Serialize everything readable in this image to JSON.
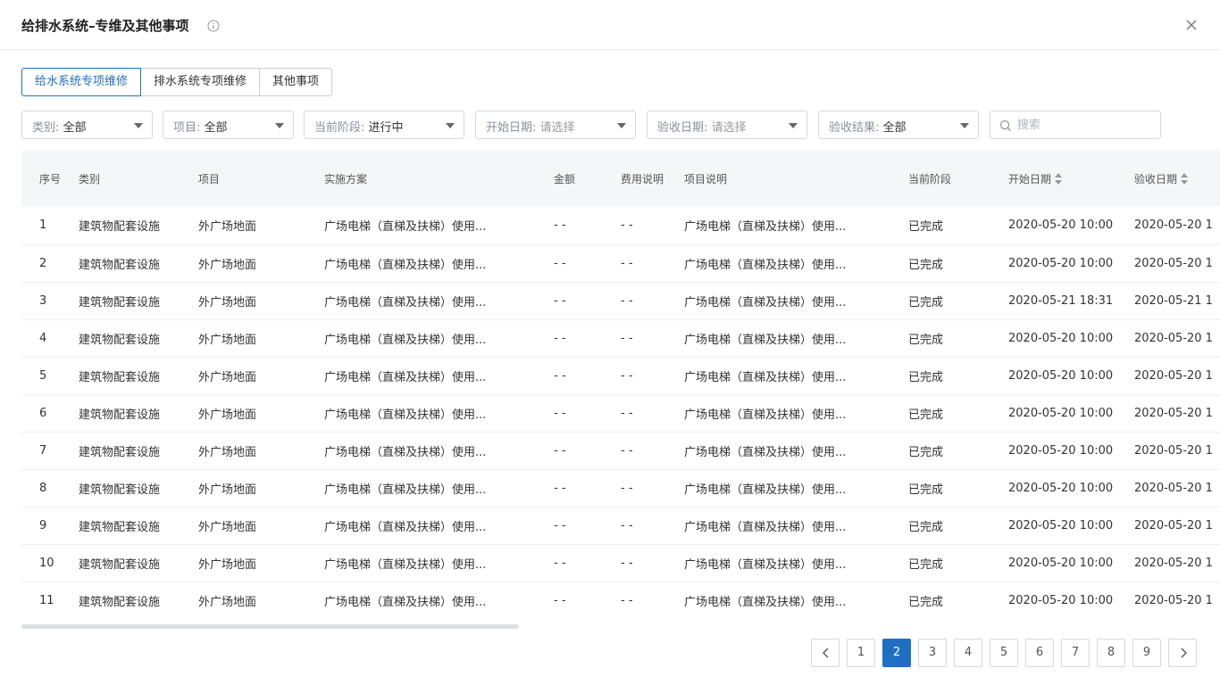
{
  "title": "给排水系统–专维及其他事项",
  "tabs": [
    {
      "label": "给水系统专项维修",
      "active": true
    },
    {
      "label": "排水系统专项维修",
      "active": false
    },
    {
      "label": "其他事项",
      "active": false
    }
  ],
  "filters": [
    {
      "label": "类别:",
      "value": "全部"
    },
    {
      "label": "项目:",
      "value": "全部"
    },
    {
      "label": "当前阶段:",
      "value": "进行中"
    },
    {
      "label": "开始日期:",
      "value": "请选择"
    },
    {
      "label": "验收日期:",
      "value": "请选择"
    },
    {
      "label": "验收结果:",
      "value": "全部"
    }
  ],
  "search": {
    "placeholder": "搜索"
  },
  "table": {
    "columns": [
      "序号",
      "类别",
      "项目",
      "实施方案",
      "金额",
      "费用说明",
      "项目说明",
      "当前阶段",
      "开始日期",
      "验收日期"
    ],
    "rows": [
      [
        "1",
        "建筑物配套设施",
        "外广场地面",
        "广场电梯（直梯及扶梯）使用...",
        "- -",
        "- -",
        "广场电梯（直梯及扶梯）使用...",
        "已完成",
        "2020-05-20 10:00",
        "2020-05-20 1"
      ],
      [
        "2",
        "建筑物配套设施",
        "外广场地面",
        "广场电梯（直梯及扶梯）使用...",
        "- -",
        "- -",
        "广场电梯（直梯及扶梯）使用...",
        "已完成",
        "2020-05-20 10:00",
        "2020-05-20 1"
      ],
      [
        "3",
        "建筑物配套设施",
        "外广场地面",
        "广场电梯（直梯及扶梯）使用...",
        "- -",
        "- -",
        "广场电梯（直梯及扶梯）使用...",
        "已完成",
        "2020-05-21 18:31",
        "2020-05-21 1"
      ],
      [
        "4",
        "建筑物配套设施",
        "外广场地面",
        "广场电梯（直梯及扶梯）使用...",
        "- -",
        "- -",
        "广场电梯（直梯及扶梯）使用...",
        "已完成",
        "2020-05-20 10:00",
        "2020-05-20 1"
      ],
      [
        "5",
        "建筑物配套设施",
        "外广场地面",
        "广场电梯（直梯及扶梯）使用...",
        "- -",
        "- -",
        "广场电梯（直梯及扶梯）使用...",
        "已完成",
        "2020-05-20 10:00",
        "2020-05-20 1"
      ],
      [
        "6",
        "建筑物配套设施",
        "外广场地面",
        "广场电梯（直梯及扶梯）使用...",
        "- -",
        "- -",
        "广场电梯（直梯及扶梯）使用...",
        "已完成",
        "2020-05-20 10:00",
        "2020-05-20 1"
      ],
      [
        "7",
        "建筑物配套设施",
        "外广场地面",
        "广场电梯（直梯及扶梯）使用...",
        "- -",
        "- -",
        "广场电梯（直梯及扶梯）使用...",
        "已完成",
        "2020-05-20 10:00",
        "2020-05-20 1"
      ],
      [
        "8",
        "建筑物配套设施",
        "外广场地面",
        "广场电梯（直梯及扶梯）使用...",
        "- -",
        "- -",
        "广场电梯（直梯及扶梯）使用...",
        "已完成",
        "2020-05-20 10:00",
        "2020-05-20 1"
      ],
      [
        "9",
        "建筑物配套设施",
        "外广场地面",
        "广场电梯（直梯及扶梯）使用...",
        "- -",
        "- -",
        "广场电梯（直梯及扶梯）使用...",
        "已完成",
        "2020-05-20 10:00",
        "2020-05-20 1"
      ],
      [
        "10",
        "建筑物配套设施",
        "外广场地面",
        "广场电梯（直梯及扶梯）使用...",
        "- -",
        "- -",
        "广场电梯（直梯及扶梯）使用...",
        "已完成",
        "2020-05-20 10:00",
        "2020-05-20 1"
      ],
      [
        "11",
        "建筑物配套设施",
        "外广场地面",
        "广场电梯（直梯及扶梯）使用...",
        "- -",
        "- -",
        "广场电梯（直梯及扶梯）使用...",
        "已完成",
        "2020-05-20 10:00",
        "2020-05-20 1"
      ]
    ]
  },
  "pagination": {
    "pages": [
      "1",
      "2",
      "3",
      "4",
      "5",
      "6",
      "7",
      "8",
      "9"
    ],
    "current": "2"
  },
  "colors": {
    "accent": "#1f6fc5",
    "header_bg": "#f5f6f8",
    "border": "#d5d8de"
  },
  "icons": {
    "info": "info-icon",
    "close": "close-icon",
    "search": "search-icon",
    "prev": "chevron-left-icon",
    "next": "chevron-right-icon",
    "sort": "sort-icon"
  }
}
